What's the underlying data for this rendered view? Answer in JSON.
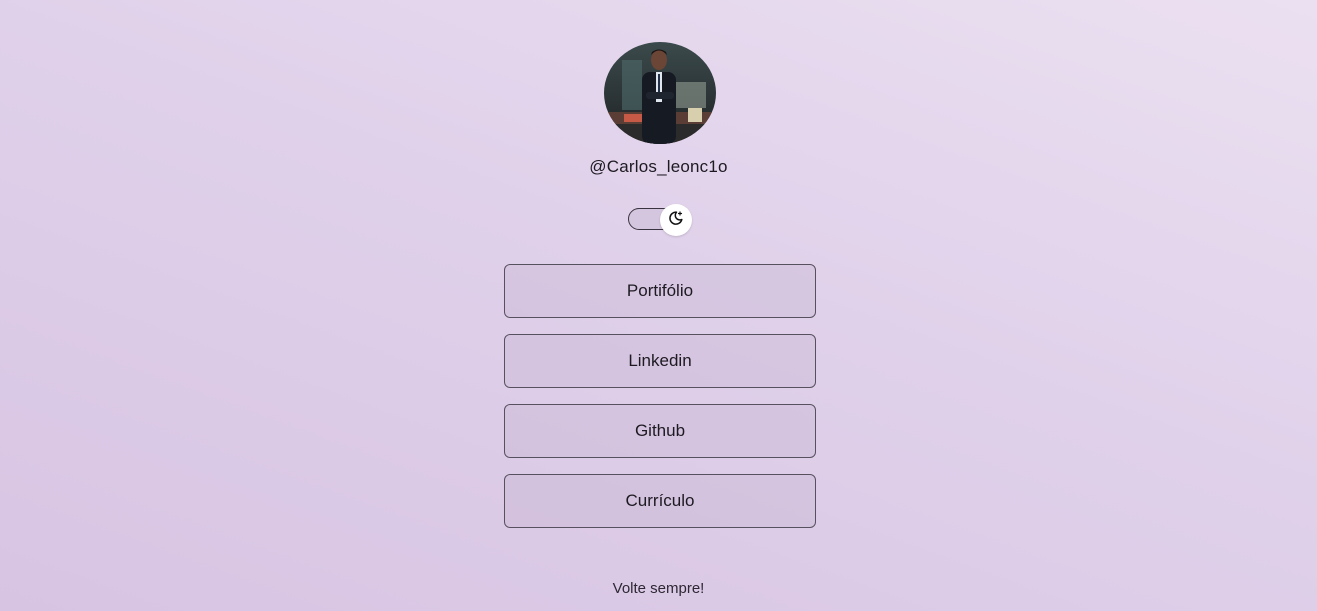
{
  "profile": {
    "username": "@Carlos_leonc1o",
    "avatar_icon": "profile-photo"
  },
  "theme_toggle": {
    "icon": "moon-stars-icon",
    "mode": "light"
  },
  "links": [
    {
      "label": "Portifólio"
    },
    {
      "label": "Linkedin"
    },
    {
      "label": "Github"
    },
    {
      "label": "Currículo"
    }
  ],
  "footer": {
    "text": "Volte sempre!"
  },
  "colors": {
    "background_start": "#ebe0f1",
    "background_end": "#d7c4e3",
    "button_border": "#57505e",
    "text": "#1d1a22"
  }
}
